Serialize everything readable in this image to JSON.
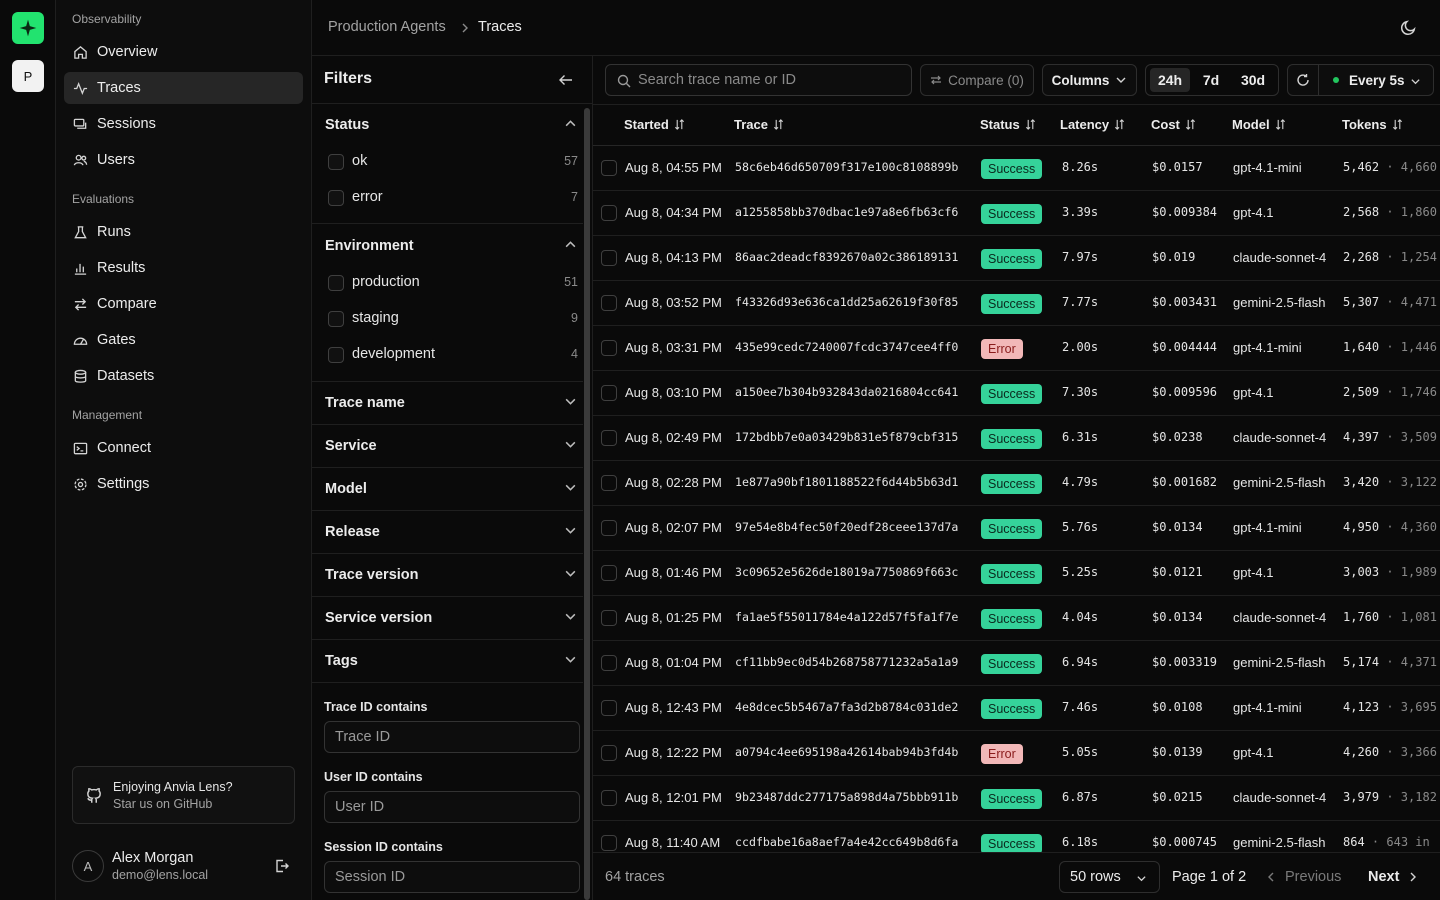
{
  "project_initial": "P",
  "breadcrumb": {
    "project": "Production Agents",
    "page": "Traces"
  },
  "sidebar": {
    "sections": [
      {
        "title": "Observability",
        "items": [
          "Overview",
          "Traces",
          "Sessions",
          "Users"
        ]
      },
      {
        "title": "Evaluations",
        "items": [
          "Runs",
          "Results",
          "Compare",
          "Gates",
          "Datasets"
        ]
      },
      {
        "title": "Management",
        "items": [
          "Connect",
          "Settings"
        ]
      }
    ],
    "active_item": "Traces",
    "promo": {
      "title": "Enjoying Anvia Lens?",
      "subtitle": "Star us on GitHub"
    },
    "user": {
      "initial": "A",
      "name": "Alex Morgan",
      "email": "demo@lens.local"
    }
  },
  "filters": {
    "title": "Filters",
    "status": {
      "label": "Status",
      "options": [
        {
          "label": "ok",
          "count": "57"
        },
        {
          "label": "error",
          "count": "7"
        }
      ]
    },
    "environment": {
      "label": "Environment",
      "options": [
        {
          "label": "production",
          "count": "51"
        },
        {
          "label": "staging",
          "count": "9"
        },
        {
          "label": "development",
          "count": "4"
        }
      ]
    },
    "collapsed_groups": [
      "Trace name",
      "Service",
      "Model",
      "Release",
      "Trace version",
      "Service version",
      "Tags"
    ],
    "trace_id": {
      "label": "Trace ID contains",
      "placeholder": "Trace ID"
    },
    "user_id": {
      "label": "User ID contains",
      "placeholder": "User ID"
    },
    "session_id": {
      "label": "Session ID contains",
      "placeholder": "Session ID"
    }
  },
  "toolbar": {
    "search_placeholder": "Search trace name or ID",
    "compare_label": "Compare (0)",
    "columns_label": "Columns",
    "ranges": [
      "24h",
      "7d",
      "30d"
    ],
    "active_range": "24h",
    "interval_label": "Every 5s"
  },
  "table": {
    "headers": [
      "Started",
      "Trace",
      "Status",
      "Latency",
      "Cost",
      "Model",
      "Tokens"
    ],
    "rows": [
      {
        "started": "Aug 8, 04:55 PM",
        "trace": "58c6eb46d650709f317e100c8108899b",
        "status": "Success",
        "latency": "8.26s",
        "cost": "$0.0157",
        "model": "gpt-4.1-mini",
        "tokens": "5,462",
        "tokens_sub": "· 4,660"
      },
      {
        "started": "Aug 8, 04:34 PM",
        "trace": "a1255858bb370dbac1e97a8e6fb63cf6",
        "status": "Success",
        "latency": "3.39s",
        "cost": "$0.009384",
        "model": "gpt-4.1",
        "tokens": "2,568",
        "tokens_sub": "· 1,860"
      },
      {
        "started": "Aug 8, 04:13 PM",
        "trace": "86aac2deadcf8392670a02c386189131",
        "status": "Success",
        "latency": "7.97s",
        "cost": "$0.019",
        "model": "claude-sonnet-4",
        "tokens": "2,268",
        "tokens_sub": "· 1,254"
      },
      {
        "started": "Aug 8, 03:52 PM",
        "trace": "f43326d93e636ca1dd25a62619f30f85",
        "status": "Success",
        "latency": "7.77s",
        "cost": "$0.003431",
        "model": "gemini-2.5-flash",
        "tokens": "5,307",
        "tokens_sub": "· 4,471"
      },
      {
        "started": "Aug 8, 03:31 PM",
        "trace": "435e99cedc7240007fcdc3747cee4ff0",
        "status": "Error",
        "latency": "2.00s",
        "cost": "$0.004444",
        "model": "gpt-4.1-mini",
        "tokens": "1,640",
        "tokens_sub": "· 1,446"
      },
      {
        "started": "Aug 8, 03:10 PM",
        "trace": "a150ee7b304b932843da0216804cc641",
        "status": "Success",
        "latency": "7.30s",
        "cost": "$0.009596",
        "model": "gpt-4.1",
        "tokens": "2,509",
        "tokens_sub": "· 1,746"
      },
      {
        "started": "Aug 8, 02:49 PM",
        "trace": "172bdbb7e0a03429b831e5f879cbf315",
        "status": "Success",
        "latency": "6.31s",
        "cost": "$0.0238",
        "model": "claude-sonnet-4",
        "tokens": "4,397",
        "tokens_sub": "· 3,509"
      },
      {
        "started": "Aug 8, 02:28 PM",
        "trace": "1e877a90bf1801188522f6d44b5b63d1",
        "status": "Success",
        "latency": "4.79s",
        "cost": "$0.001682",
        "model": "gemini-2.5-flash",
        "tokens": "3,420",
        "tokens_sub": "· 3,122"
      },
      {
        "started": "Aug 8, 02:07 PM",
        "trace": "97e54e8b4fec50f20edf28ceee137d7a",
        "status": "Success",
        "latency": "5.76s",
        "cost": "$0.0134",
        "model": "gpt-4.1-mini",
        "tokens": "4,950",
        "tokens_sub": "· 4,360"
      },
      {
        "started": "Aug 8, 01:46 PM",
        "trace": "3c09652e5626de18019a7750869f663c",
        "status": "Success",
        "latency": "5.25s",
        "cost": "$0.0121",
        "model": "gpt-4.1",
        "tokens": "3,003",
        "tokens_sub": "· 1,989"
      },
      {
        "started": "Aug 8, 01:25 PM",
        "trace": "fa1ae5f55011784e4a122d57f5fa1f7e",
        "status": "Success",
        "latency": "4.04s",
        "cost": "$0.0134",
        "model": "claude-sonnet-4",
        "tokens": "1,760",
        "tokens_sub": "· 1,081"
      },
      {
        "started": "Aug 8, 01:04 PM",
        "trace": "cf11bb9ec0d54b268758771232a5a1a9",
        "status": "Success",
        "latency": "6.94s",
        "cost": "$0.003319",
        "model": "gemini-2.5-flash",
        "tokens": "5,174",
        "tokens_sub": "· 4,371"
      },
      {
        "started": "Aug 8, 12:43 PM",
        "trace": "4e8dcec5b5467a7fa3d2b8784c031de2",
        "status": "Success",
        "latency": "7.46s",
        "cost": "$0.0108",
        "model": "gpt-4.1-mini",
        "tokens": "4,123",
        "tokens_sub": "· 3,695"
      },
      {
        "started": "Aug 8, 12:22 PM",
        "trace": "a0794c4ee695198a42614bab94b3fd4b",
        "status": "Error",
        "latency": "5.05s",
        "cost": "$0.0139",
        "model": "gpt-4.1",
        "tokens": "4,260",
        "tokens_sub": "· 3,366"
      },
      {
        "started": "Aug 8, 12:01 PM",
        "trace": "9b23487ddc277175a898d4a75bbb911b",
        "status": "Success",
        "latency": "6.87s",
        "cost": "$0.0215",
        "model": "claude-sonnet-4",
        "tokens": "3,979",
        "tokens_sub": "· 3,182"
      },
      {
        "started": "Aug 8, 11:40 AM",
        "trace": "ccdfbabe16a8aef7a4e42cc649b8d6fa",
        "status": "Success",
        "latency": "6.18s",
        "cost": "$0.000745",
        "model": "gemini-2.5-flash",
        "tokens": "864",
        "tokens_sub": "· 643 in"
      }
    ]
  },
  "footer": {
    "count_label": "64 traces",
    "rows_label": "50 rows",
    "page_label": "Page 1 of 2",
    "prev_label": "Previous",
    "next_label": "Next"
  },
  "colors": {
    "brand": "#22e36f",
    "success_badge": "#35d39a",
    "error_badge": "#f2b8b8",
    "live_dot": "#22c55e"
  }
}
